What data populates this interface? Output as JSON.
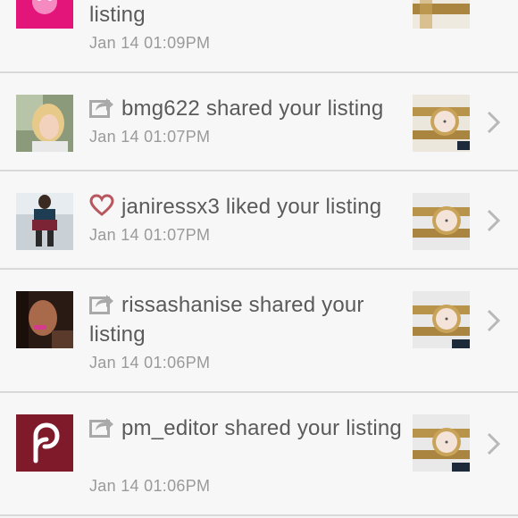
{
  "notifications": [
    {
      "username": "",
      "action_text": "listing",
      "action_icon": "",
      "timestamp": "Jan 14 01:09PM",
      "avatar_icon": "pink-avatar-icon"
    },
    {
      "username": "bmg622",
      "action_text": "shared your listing",
      "action_icon": "share-icon",
      "timestamp": "Jan 14 01:07PM",
      "avatar_icon": "user-photo-blonde"
    },
    {
      "username": "janiressx3",
      "action_text": "liked your listing",
      "action_icon": "heart-icon",
      "timestamp": "Jan 14 01:07PM",
      "avatar_icon": "user-photo-outfit"
    },
    {
      "username": "rissashanise",
      "action_text": "shared your listing",
      "action_icon": "share-icon",
      "timestamp": "Jan 14 01:06PM",
      "avatar_icon": "user-photo-selfie"
    },
    {
      "username": "pm_editor",
      "action_text": "shared your listing",
      "action_icon": "share-icon",
      "timestamp": "Jan 14 01:06PM",
      "avatar_icon": "poshmark-logo-icon"
    }
  ],
  "colors": {
    "background": "#f7f7f7",
    "divider": "#d9d9d9",
    "text": "#5a5a5a",
    "timestamp": "#9a9a9a",
    "heart": "#b9575f",
    "share": "#a9a9a9",
    "brand": "#7f1a2a",
    "pink": "#e3157a"
  }
}
